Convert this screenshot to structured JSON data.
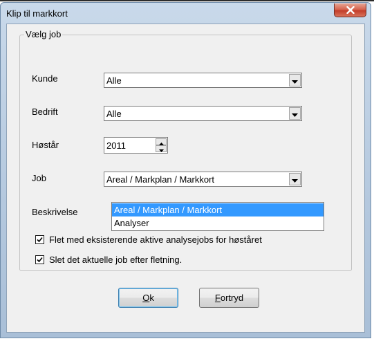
{
  "window": {
    "title": "Klip til markkort",
    "close_icon": "close-x-icon"
  },
  "group": {
    "legend": "Vælg job"
  },
  "fields": {
    "kunde": {
      "label": "Kunde",
      "value": "Alle"
    },
    "bedrift": {
      "label": "Bedrift",
      "value": "Alle"
    },
    "hoestaar": {
      "label": "Høstår",
      "value": "2011"
    },
    "job": {
      "label": "Job",
      "value": "Areal / Markplan / Markkort"
    },
    "beskrivelse": {
      "label": "Beskrivelse"
    }
  },
  "job_dropdown": {
    "options": [
      "Areal / Markplan / Markkort",
      "Analyser"
    ],
    "selected_index": 0
  },
  "checkboxes": [
    {
      "label": "Flet med eksisterende aktive analysejobs for høståret",
      "checked": true
    },
    {
      "label": "Slet det aktuelle job efter fletning.",
      "checked": true
    }
  ],
  "buttons": {
    "ok": {
      "accel": "O",
      "rest": "k"
    },
    "cancel": {
      "accel": "F",
      "rest": "ortryd"
    }
  },
  "colors": {
    "selection": "#3399ff",
    "close_button": "#c23e2a"
  }
}
